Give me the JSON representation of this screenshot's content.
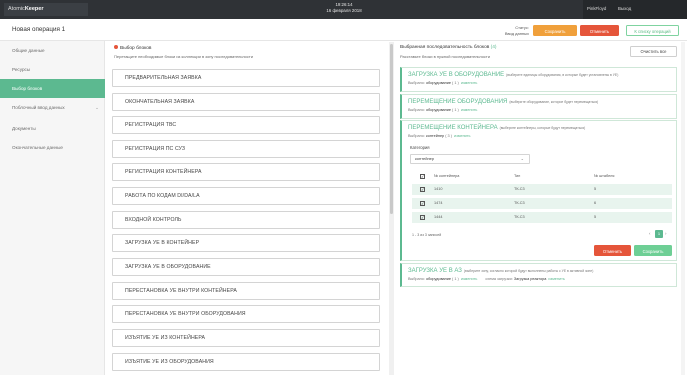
{
  "topbar": {
    "logo_prefix": "Atomic",
    "logo_suffix": "Keeper",
    "time": "19:26:14",
    "date": "16 февраля 2018",
    "user": "PinkFloyd",
    "logout": "Выход"
  },
  "operation": {
    "title": "Новая операция 1",
    "status_label": "Статус:",
    "status_value": "Ввод данных",
    "save": "Сохранить",
    "cancel": "Отменить",
    "finish": "К списку операций"
  },
  "sidebar": {
    "items": [
      {
        "label": "Общие данные"
      },
      {
        "label": "Ресурсы"
      },
      {
        "label": "Выбор блоков"
      },
      {
        "label": "Поблочный ввод данных"
      },
      {
        "label": "Документы"
      },
      {
        "label": "Окончательные данные"
      }
    ]
  },
  "blocks_panel": {
    "title": "Выбор блоков",
    "subtitle": "Перетащите необходимые блоки из коллекции в зону последовательности",
    "blocks": [
      "ПРЕДВАРИТЕЛЬНАЯ ЗАЯВКА",
      "ОКОНЧАТЕЛЬНАЯ ЗАЯВКА",
      "РЕГИСТРАЦИЯ ТВС",
      "РЕГИСТРАЦИЯ ПС СУЗ",
      "РЕГИСТРАЦИЯ КОНТЕЙНЕРА",
      "РАБОТА ПО КОДАМ DI/DA/LA",
      "ВХОДНОЙ КОНТРОЛЬ",
      "ЗАГРУЗКА УЕ В КОНТЕЙНЕР",
      "ЗАГРУЗКА УЕ В ОБОРУДОВАНИЕ",
      "ПЕРЕСТАНОВКА УЕ ВНУТРИ КОНТЕЙНЕРА",
      "ПЕРЕСТАНОВКА УЕ ВНУТРИ ОБОРУДОВАНИЯ",
      "ИЗЪЯТИЕ УЕ ИЗ КОНТЕЙНЕРА",
      "ИЗЪЯТИЕ УЕ ИЗ ОБОРУДОВАНИЯ"
    ]
  },
  "sequence_panel": {
    "title": "Выбранная последовательность блоков",
    "count": "(4)",
    "subtitle": "Расставьте блоки в нужной последовательности",
    "clear_all": "Очистить все",
    "cards": [
      {
        "title": "ЗАГРУЗКА УЕ В ОБОРУДОВАНИЕ",
        "hint": "(выберите единицы оборудования, в которые будет установлены в УЕ)",
        "selected_label": "Выбрано:",
        "selected_value": "оборудование",
        "selected_count": "( 1 )",
        "edit": "изменить"
      },
      {
        "title": "ПЕРЕМЕЩЕНИЕ ОБОРУДОВАНИЯ",
        "hint": "(выберите оборудование, которое будет перемещаться)",
        "selected_label": "Выбрано:",
        "selected_value": "оборудование",
        "selected_count": "( 1 )",
        "edit": "изменить"
      },
      {
        "title": "ПЕРЕМЕЩЕНИЕ КОНТЕЙНЕРА",
        "hint": "(выберите контейнеры, которые будут перемещаться)",
        "selected_label": "Выбрано:",
        "selected_value": "контейнер",
        "selected_count": "( 3 )",
        "edit": "изменить",
        "category_label": "Категория",
        "category_value": "контейнер",
        "columns": [
          "№ контейнера",
          "Тип",
          "№ штабеля"
        ],
        "rows": [
          [
            "1410",
            "ТК-С3",
            "5"
          ],
          [
            "1474",
            "ТК-С3",
            "6"
          ],
          [
            "1444",
            "ТК-С3",
            "5"
          ]
        ],
        "pager_info": "1 - 3 из 3 записей",
        "prev": "‹",
        "page": "1",
        "next": "›",
        "cancel": "Отменить",
        "save": "Сохранить"
      },
      {
        "title": "ЗАГРУЗКА УЕ В АЗ",
        "hint": "(выберите зону, согласно которой будут выполнены работы с УЕ в активной зоне)",
        "selected_label": "Выбрано:",
        "selected_value": "оборудование",
        "selected_count": "( 1 )",
        "edit": "изменить",
        "extra_label": "схема загрузки:",
        "extra_value": "Загрузка реактора",
        "extra_edit": "изменить"
      }
    ]
  },
  "colors": {
    "accent": "#5cb990",
    "save": "#f0a03b",
    "cancel": "#e5553a",
    "topbar": "#2f3236"
  },
  "icons": [
    "check-icon",
    "chevron-down-icon",
    "caret-down-icon"
  ]
}
